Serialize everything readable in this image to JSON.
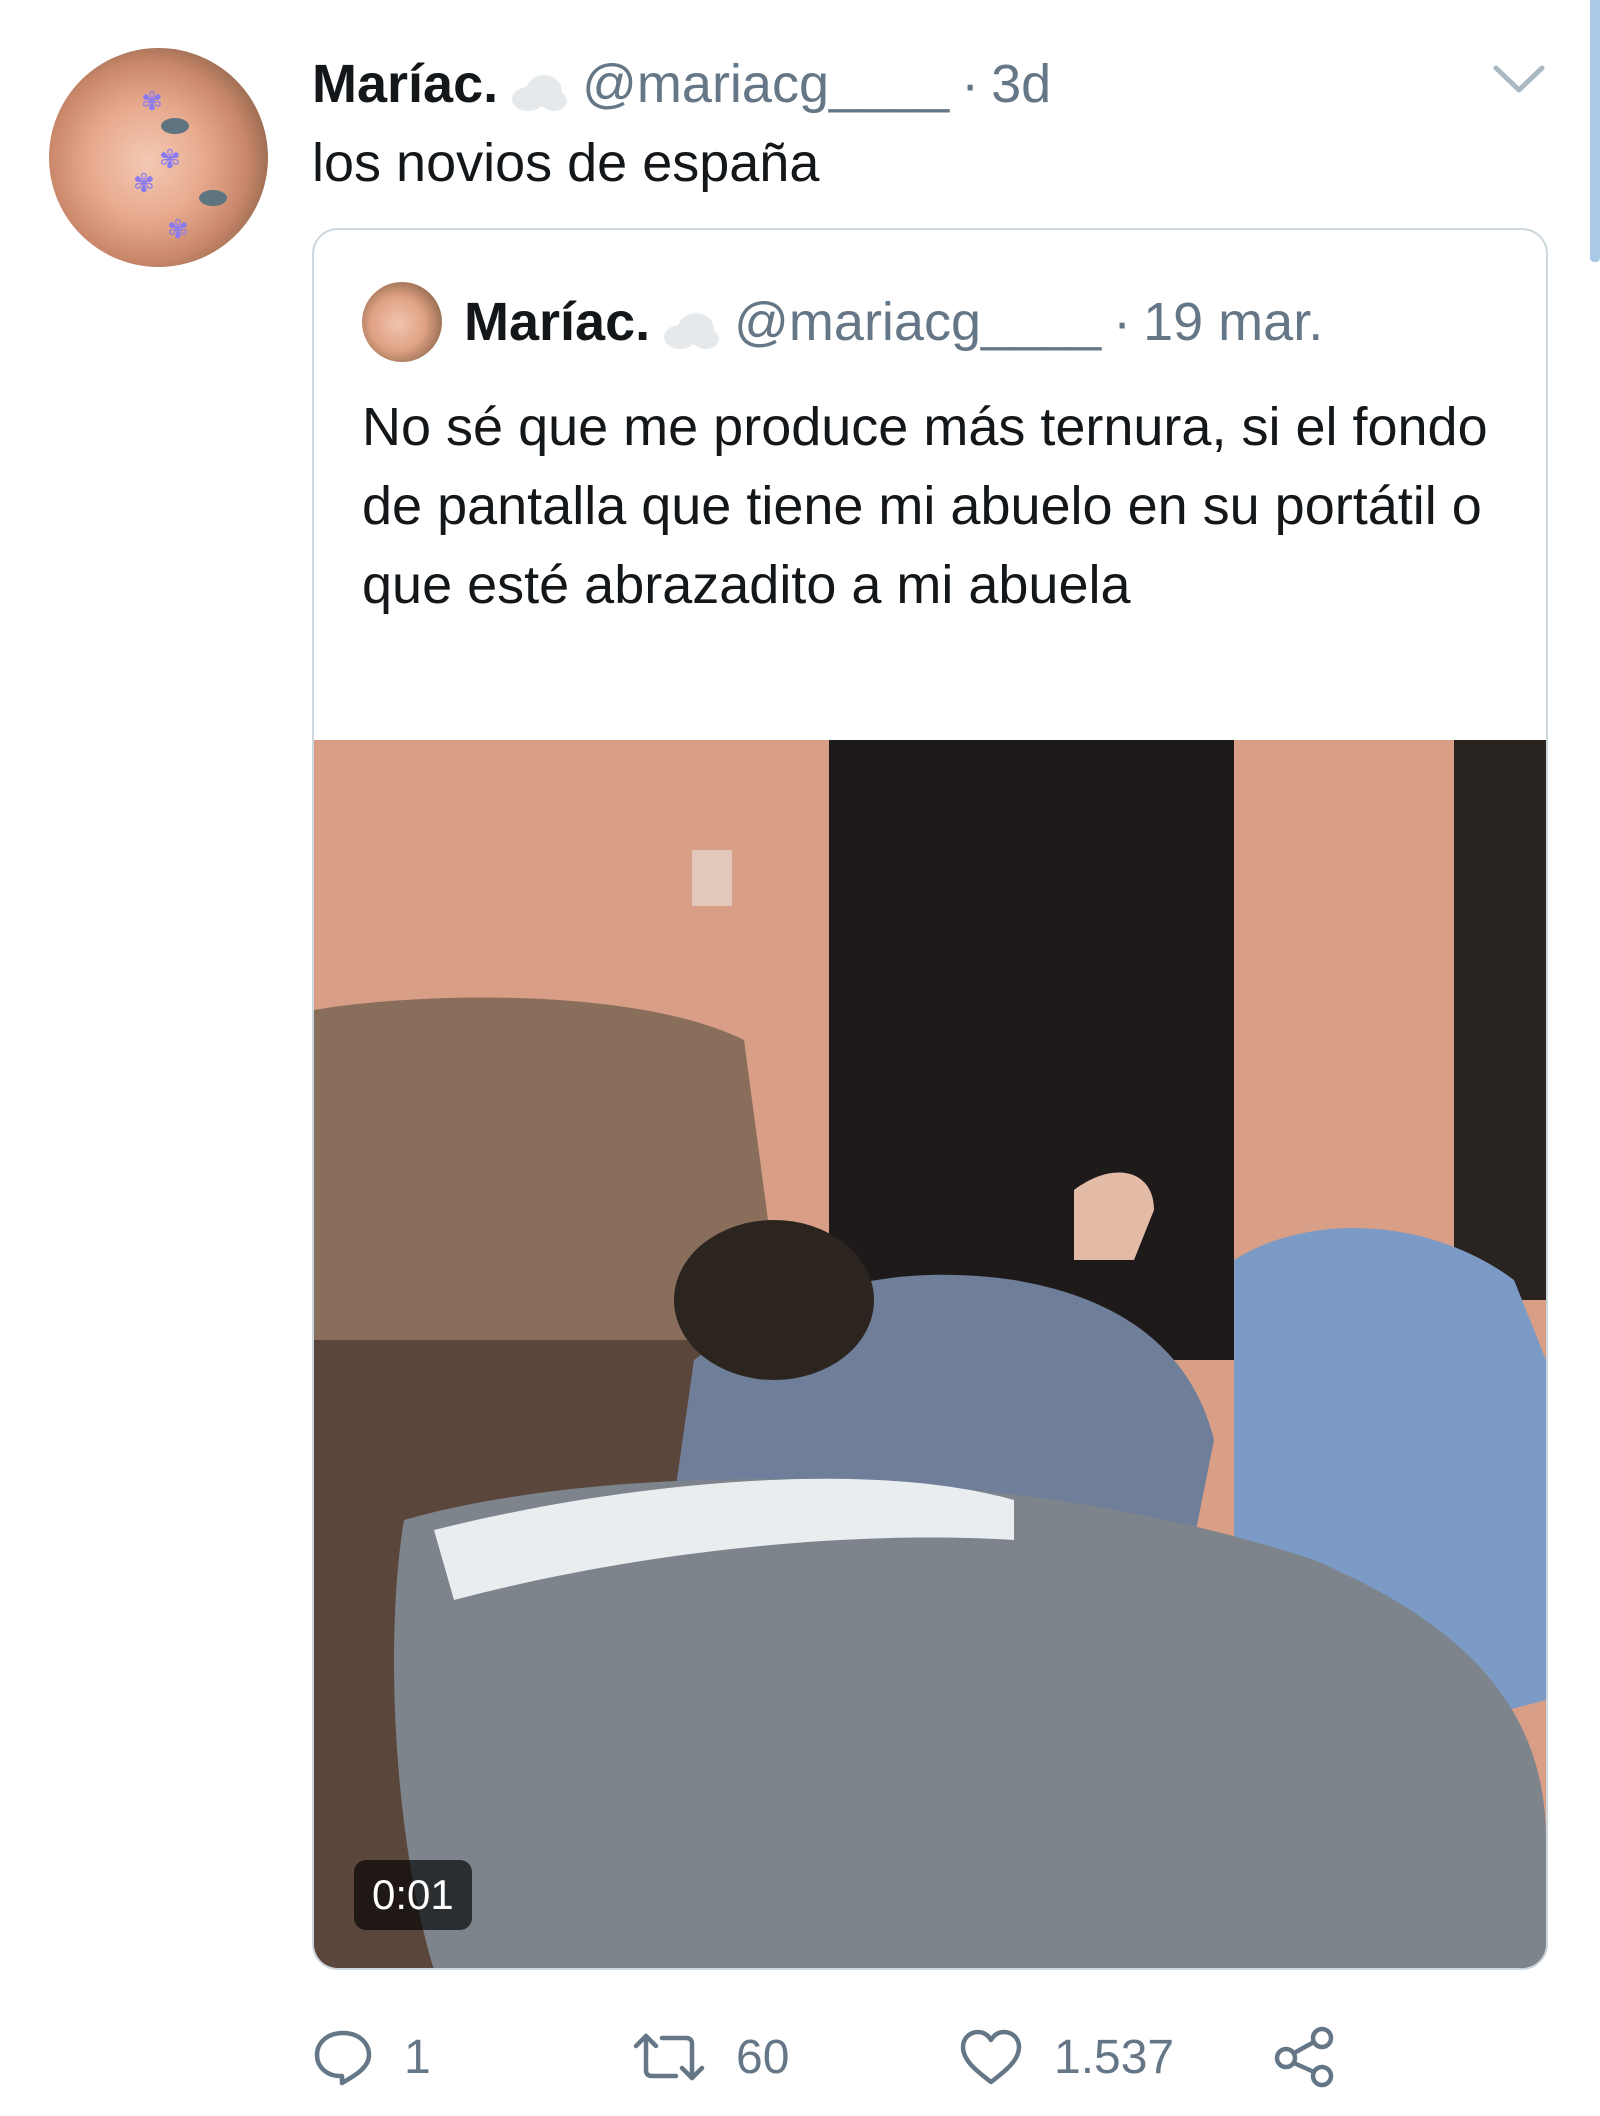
{
  "tweet": {
    "author_name": "Maríac.",
    "handle": "@mariacg____",
    "separator": "·",
    "time": "3d",
    "text": "los novios de españa"
  },
  "quoted": {
    "author_name": "Maríac.",
    "handle": "@mariacg____",
    "separator": "·",
    "time": "19 mar.",
    "text": "No sé que me produce más ternura, si el fondo de pantalla que tiene mi abuelo en su portátil o que esté abrazadito a mi abuela",
    "video_duration": "0:01"
  },
  "actions": {
    "replies": "1",
    "retweets": "60",
    "likes": "1.537"
  },
  "icons": [
    "cloud-icon",
    "chevron-down-icon",
    "reply-icon",
    "retweet-icon",
    "heart-icon",
    "share-icon"
  ],
  "colors": {
    "secondary_text": "#657786",
    "border": "#ccd6dd",
    "accent": "#1da1f2"
  }
}
